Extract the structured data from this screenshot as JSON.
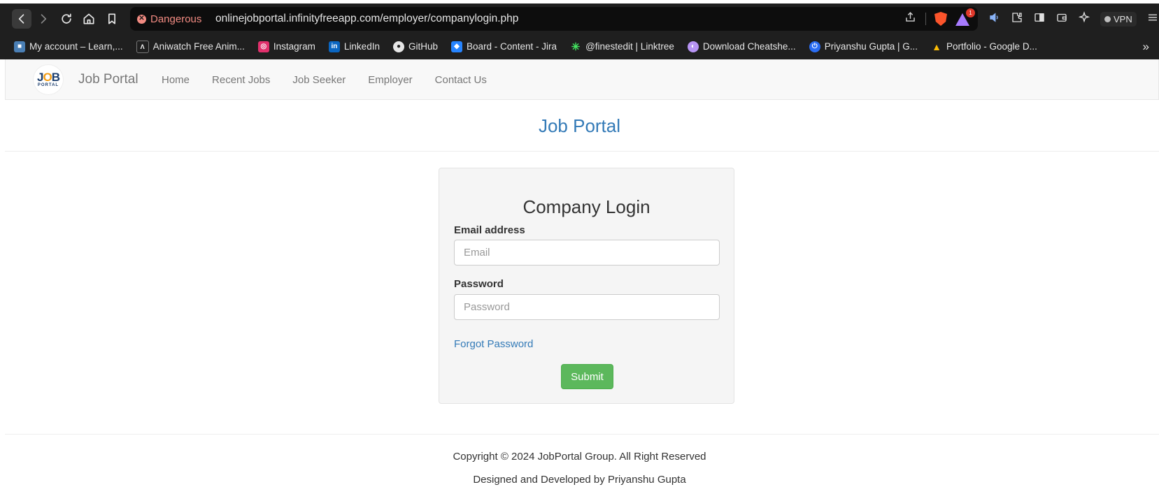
{
  "browser": {
    "security_label": "Dangerous",
    "url": "onlinejobportal.infinityfreeapp.com/employer/companylogin.php",
    "rewards_badge": "1",
    "vpn_label": "VPN",
    "bookmarks": [
      {
        "label": "My account – Learn,...",
        "icon_color": "#4a7fb5"
      },
      {
        "label": "Aniwatch Free Anim...",
        "icon_color": "#1f1f1f"
      },
      {
        "label": "Instagram",
        "icon_color": "#e1306c"
      },
      {
        "label": "LinkedIn",
        "icon_color": "#0a66c2"
      },
      {
        "label": "GitHub",
        "icon_color": "#1f1f1f"
      },
      {
        "label": "Board - Content - Jira",
        "icon_color": "#2684ff"
      },
      {
        "label": "@finestedit | Linktree",
        "icon_color": "#43e660"
      },
      {
        "label": "Download Cheatshe...",
        "icon_color": "#b794f4"
      },
      {
        "label": "Priyanshu Gupta | G...",
        "icon_color": "#2a6df4"
      },
      {
        "label": "Portfolio - Google D...",
        "icon_color": "#34a853"
      }
    ],
    "bookmarks_more": "»"
  },
  "navbar": {
    "logo_main_left": "J",
    "logo_main_o": "O",
    "logo_main_right": "B",
    "logo_sub": "PORTAL",
    "brand": "Job Portal",
    "links": [
      "Home",
      "Recent Jobs",
      "Job Seeker",
      "Employer",
      "Contact Us"
    ]
  },
  "heading": "Job Portal",
  "login": {
    "title": "Company Login",
    "email_label": "Email address",
    "email_placeholder": "Email",
    "password_label": "Password",
    "password_placeholder": "Password",
    "forgot_label": "Forgot Password",
    "submit_label": "Submit"
  },
  "footer": {
    "copyright": "Copyright © 2024 JobPortal Group. All Right Reserved",
    "credit": "Designed and Developed by Priyanshu Gupta"
  },
  "colors": {
    "link": "#337ab7",
    "submit": "#5cb85c",
    "danger": "#f28b82"
  }
}
